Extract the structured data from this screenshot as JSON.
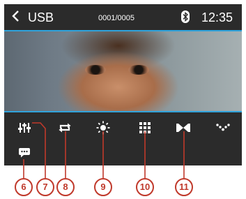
{
  "header": {
    "back_icon": "chevron-left-icon",
    "source_label": "USB",
    "track_counter": "0001/0005",
    "bluetooth_icon": "bluetooth-icon",
    "clock": "12:35"
  },
  "controls": [
    {
      "name": "equalizer",
      "icon": "sliders-icon",
      "callout": "7"
    },
    {
      "name": "repeat",
      "icon": "repeat-icon",
      "callout": "8"
    },
    {
      "name": "brightness",
      "icon": "sun-icon",
      "callout": "9"
    },
    {
      "name": "grid",
      "icon": "grid-icon",
      "callout": "10"
    },
    {
      "name": "fit",
      "icon": "fit-icon",
      "callout": "11"
    },
    {
      "name": "more",
      "icon": "dots-chevron-icon",
      "callout": ""
    },
    {
      "name": "info",
      "icon": "speech-bubble-icon",
      "callout": "6"
    }
  ],
  "callouts": [
    "6",
    "7",
    "8",
    "9",
    "10",
    "11"
  ],
  "colors": {
    "accent_line": "#2fa3dc",
    "bar_background": "#2b2b2b",
    "callout_red": "#c0392b",
    "icon_white": "#ffffff"
  }
}
